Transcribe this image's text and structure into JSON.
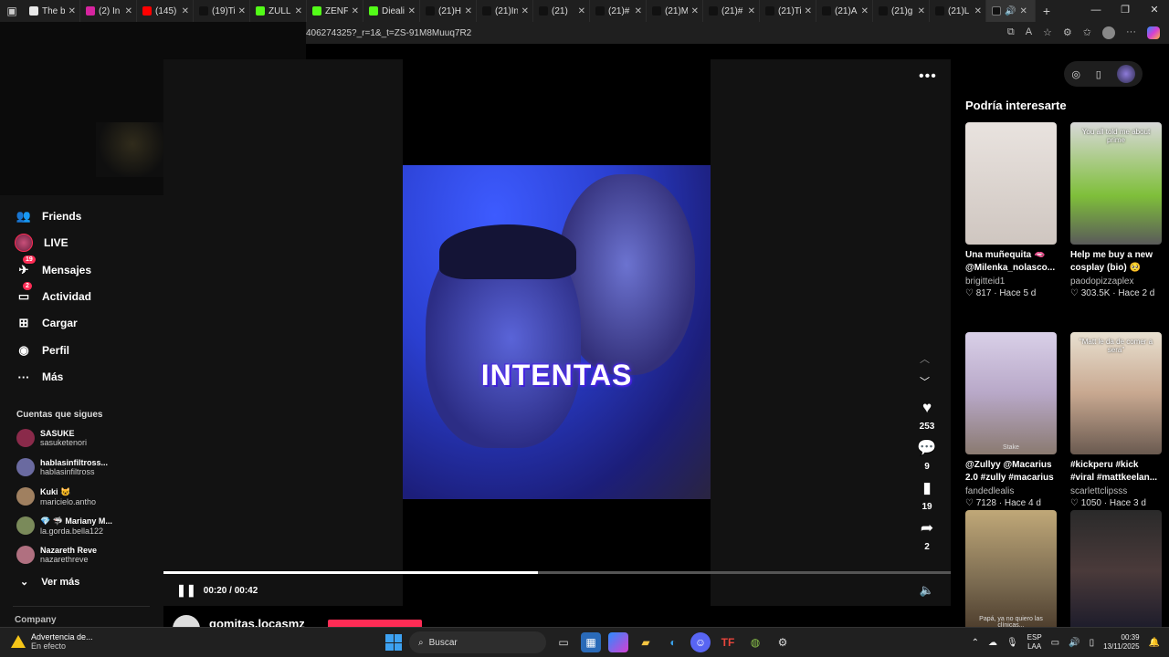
{
  "tabs": [
    {
      "title": "The b",
      "fav": "#e8e8e8"
    },
    {
      "title": "(2) In",
      "fav": "#d6249f"
    },
    {
      "title": "(145)",
      "fav": "#ff0000"
    },
    {
      "title": "(19)Ti",
      "fav": "#111111"
    },
    {
      "title": "ZULL",
      "fav": "#53fc18"
    },
    {
      "title": "ZENF",
      "fav": "#53fc18"
    },
    {
      "title": "Dieali",
      "fav": "#53fc18"
    },
    {
      "title": "(21)H",
      "fav": "#111111"
    },
    {
      "title": "(21)In",
      "fav": "#111111"
    },
    {
      "title": "(21)",
      "fav": "#111111"
    },
    {
      "title": "(21)#",
      "fav": "#111111"
    },
    {
      "title": "(21)M",
      "fav": "#111111"
    },
    {
      "title": "(21)#",
      "fav": "#111111"
    },
    {
      "title": "(21)Ti",
      "fav": "#111111"
    },
    {
      "title": "(21)A",
      "fav": "#111111"
    },
    {
      "title": "(21)g",
      "fav": "#111111"
    },
    {
      "title": "(21)L",
      "fav": "#111111"
    }
  ],
  "window_controls": {
    "minimize": "—",
    "maximize": "❐",
    "close": "✕"
  },
  "address": {
    "url": "406274325?_r=1&_t=ZS-91M8Muuq7R2"
  },
  "sidebar": {
    "nav": [
      {
        "label": "Friends",
        "icon": "friends-icon",
        "glyph": "👥"
      },
      {
        "label": "LIVE",
        "icon": "live-icon",
        "glyph": ""
      },
      {
        "label": "Mensajes",
        "icon": "messages-icon",
        "glyph": "✈",
        "badge": "19"
      },
      {
        "label": "Actividad",
        "icon": "activity-icon",
        "glyph": "▭",
        "badge": "2"
      },
      {
        "label": "Cargar",
        "icon": "upload-icon",
        "glyph": "⊞"
      },
      {
        "label": "Perfil",
        "icon": "profile-icon",
        "glyph": "◉"
      },
      {
        "label": "Más",
        "icon": "more-icon",
        "glyph": "···"
      }
    ],
    "following_label": "Cuentas que sigues",
    "following": [
      {
        "name": "SASUKE",
        "handle": "sasuketenori",
        "color": "#8a2a4a"
      },
      {
        "name": "hablasinfiltross...",
        "handle": "hablasinfiltross",
        "color": "#6a6aa0"
      },
      {
        "name": "Kuki 😺",
        "handle": "maricielo.antho",
        "color": "#a08060"
      },
      {
        "name": "💎 🦈 Mariany M...",
        "handle": "la.gorda.bella122",
        "color": "#7a8a5a"
      },
      {
        "name": "Nazareth Reve",
        "handle": "nazarethreve",
        "color": "#b07080"
      }
    ],
    "see_more": "Ver más",
    "company": "Company"
  },
  "player": {
    "caption": "INTENTAS",
    "likes": "253",
    "comments": "9",
    "saves": "19",
    "shares": "2",
    "time": "00:20 / 00:42",
    "progress": 0.476,
    "username": "gomitas.locasmz"
  },
  "recommendations": {
    "title": "Podría interesarte",
    "items": [
      {
        "desc": "Una muñequita 🫦 @Milenka_nolasco...",
        "author": "brigitteid1",
        "stats": "♡ 817 · Hace 5 d",
        "bg": "linear-gradient(180deg,#e9e3df,#cfc6c0)",
        "overlay": "",
        "overlay2": ""
      },
      {
        "desc": "Help me buy a new cosplay (bio) 🥺",
        "author": "paodopizzaplex",
        "stats": "♡ 303.5K · Hace 2 d",
        "bg": "linear-gradient(180deg,#d8d8d8,#7fbf3a 60%,#5a5a5a)",
        "overlay": "You all told me about prime",
        "overlay2": ""
      },
      {
        "desc": "@Zullyy @Macarius 2.0 #zully #macarius",
        "author": "fandedlealis",
        "stats": "♡ 7128 · Hace 4 d",
        "bg": "linear-gradient(180deg,#d9d0e8,#b8a8c8 50%,#8a7a70)",
        "overlay": "",
        "overlay2": "Stake"
      },
      {
        "desc": "#kickperu #kick #viral #mattkeelan...",
        "author": "scarlettclipsss",
        "stats": "♡ 1050 · Hace 3 d",
        "bg": "linear-gradient(180deg,#e8e0d0,#c8a890 50%,#6a5a50)",
        "overlay": "\"Matt le da de comer a sera\"",
        "overlay2": ""
      },
      {
        "desc": "",
        "author": "",
        "stats": "",
        "bg": "linear-gradient(180deg,#c0a878,#7a6a50 60%,#4a3a2a)",
        "overlay": "",
        "overlay2": "Papá, ya no quiero las clínicas..."
      },
      {
        "desc": "",
        "author": "",
        "stats": "",
        "bg": "linear-gradient(180deg,#2a2a2a,#4a3a3a 50%,#1a1a2a)",
        "overlay": "",
        "overlay2": ""
      }
    ]
  },
  "taskbar": {
    "warning_title": "Advertencia de...",
    "warning_sub": "En efecto",
    "search": "Buscar",
    "lang_top": "ESP",
    "lang_bottom": "LAA",
    "time": "00:39",
    "date": "13/11/2025"
  }
}
